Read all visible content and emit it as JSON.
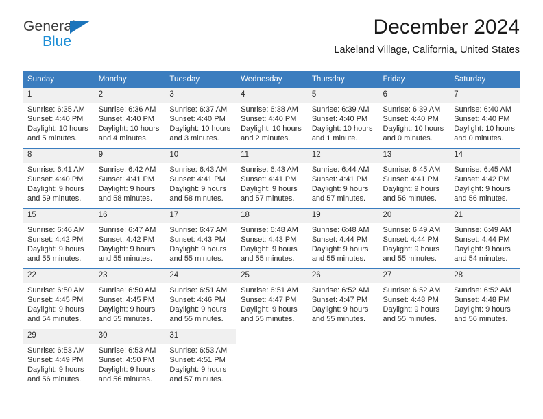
{
  "brand": {
    "name_top": "General",
    "name_bottom": "Blue",
    "triangle_color": "#1b74bb",
    "bottom_color": "#1f8fd6"
  },
  "header": {
    "month_title": "December 2024",
    "location": "Lakeland Village, California, United States",
    "header_bg": "#3b7dbf",
    "daynum_bg": "#f0f0f0"
  },
  "weekday_headers": [
    "Sunday",
    "Monday",
    "Tuesday",
    "Wednesday",
    "Thursday",
    "Friday",
    "Saturday"
  ],
  "weeks": [
    [
      {
        "day": "1",
        "lines": [
          "Sunrise: 6:35 AM",
          "Sunset: 4:40 PM",
          "Daylight: 10 hours",
          "and 5 minutes."
        ]
      },
      {
        "day": "2",
        "lines": [
          "Sunrise: 6:36 AM",
          "Sunset: 4:40 PM",
          "Daylight: 10 hours",
          "and 4 minutes."
        ]
      },
      {
        "day": "3",
        "lines": [
          "Sunrise: 6:37 AM",
          "Sunset: 4:40 PM",
          "Daylight: 10 hours",
          "and 3 minutes."
        ]
      },
      {
        "day": "4",
        "lines": [
          "Sunrise: 6:38 AM",
          "Sunset: 4:40 PM",
          "Daylight: 10 hours",
          "and 2 minutes."
        ]
      },
      {
        "day": "5",
        "lines": [
          "Sunrise: 6:39 AM",
          "Sunset: 4:40 PM",
          "Daylight: 10 hours",
          "and 1 minute."
        ]
      },
      {
        "day": "6",
        "lines": [
          "Sunrise: 6:39 AM",
          "Sunset: 4:40 PM",
          "Daylight: 10 hours",
          "and 0 minutes."
        ]
      },
      {
        "day": "7",
        "lines": [
          "Sunrise: 6:40 AM",
          "Sunset: 4:40 PM",
          "Daylight: 10 hours",
          "and 0 minutes."
        ]
      }
    ],
    [
      {
        "day": "8",
        "lines": [
          "Sunrise: 6:41 AM",
          "Sunset: 4:40 PM",
          "Daylight: 9 hours",
          "and 59 minutes."
        ]
      },
      {
        "day": "9",
        "lines": [
          "Sunrise: 6:42 AM",
          "Sunset: 4:41 PM",
          "Daylight: 9 hours",
          "and 58 minutes."
        ]
      },
      {
        "day": "10",
        "lines": [
          "Sunrise: 6:43 AM",
          "Sunset: 4:41 PM",
          "Daylight: 9 hours",
          "and 58 minutes."
        ]
      },
      {
        "day": "11",
        "lines": [
          "Sunrise: 6:43 AM",
          "Sunset: 4:41 PM",
          "Daylight: 9 hours",
          "and 57 minutes."
        ]
      },
      {
        "day": "12",
        "lines": [
          "Sunrise: 6:44 AM",
          "Sunset: 4:41 PM",
          "Daylight: 9 hours",
          "and 57 minutes."
        ]
      },
      {
        "day": "13",
        "lines": [
          "Sunrise: 6:45 AM",
          "Sunset: 4:41 PM",
          "Daylight: 9 hours",
          "and 56 minutes."
        ]
      },
      {
        "day": "14",
        "lines": [
          "Sunrise: 6:45 AM",
          "Sunset: 4:42 PM",
          "Daylight: 9 hours",
          "and 56 minutes."
        ]
      }
    ],
    [
      {
        "day": "15",
        "lines": [
          "Sunrise: 6:46 AM",
          "Sunset: 4:42 PM",
          "Daylight: 9 hours",
          "and 55 minutes."
        ]
      },
      {
        "day": "16",
        "lines": [
          "Sunrise: 6:47 AM",
          "Sunset: 4:42 PM",
          "Daylight: 9 hours",
          "and 55 minutes."
        ]
      },
      {
        "day": "17",
        "lines": [
          "Sunrise: 6:47 AM",
          "Sunset: 4:43 PM",
          "Daylight: 9 hours",
          "and 55 minutes."
        ]
      },
      {
        "day": "18",
        "lines": [
          "Sunrise: 6:48 AM",
          "Sunset: 4:43 PM",
          "Daylight: 9 hours",
          "and 55 minutes."
        ]
      },
      {
        "day": "19",
        "lines": [
          "Sunrise: 6:48 AM",
          "Sunset: 4:44 PM",
          "Daylight: 9 hours",
          "and 55 minutes."
        ]
      },
      {
        "day": "20",
        "lines": [
          "Sunrise: 6:49 AM",
          "Sunset: 4:44 PM",
          "Daylight: 9 hours",
          "and 55 minutes."
        ]
      },
      {
        "day": "21",
        "lines": [
          "Sunrise: 6:49 AM",
          "Sunset: 4:44 PM",
          "Daylight: 9 hours",
          "and 54 minutes."
        ]
      }
    ],
    [
      {
        "day": "22",
        "lines": [
          "Sunrise: 6:50 AM",
          "Sunset: 4:45 PM",
          "Daylight: 9 hours",
          "and 54 minutes."
        ]
      },
      {
        "day": "23",
        "lines": [
          "Sunrise: 6:50 AM",
          "Sunset: 4:45 PM",
          "Daylight: 9 hours",
          "and 55 minutes."
        ]
      },
      {
        "day": "24",
        "lines": [
          "Sunrise: 6:51 AM",
          "Sunset: 4:46 PM",
          "Daylight: 9 hours",
          "and 55 minutes."
        ]
      },
      {
        "day": "25",
        "lines": [
          "Sunrise: 6:51 AM",
          "Sunset: 4:47 PM",
          "Daylight: 9 hours",
          "and 55 minutes."
        ]
      },
      {
        "day": "26",
        "lines": [
          "Sunrise: 6:52 AM",
          "Sunset: 4:47 PM",
          "Daylight: 9 hours",
          "and 55 minutes."
        ]
      },
      {
        "day": "27",
        "lines": [
          "Sunrise: 6:52 AM",
          "Sunset: 4:48 PM",
          "Daylight: 9 hours",
          "and 55 minutes."
        ]
      },
      {
        "day": "28",
        "lines": [
          "Sunrise: 6:52 AM",
          "Sunset: 4:48 PM",
          "Daylight: 9 hours",
          "and 56 minutes."
        ]
      }
    ],
    [
      {
        "day": "29",
        "lines": [
          "Sunrise: 6:53 AM",
          "Sunset: 4:49 PM",
          "Daylight: 9 hours",
          "and 56 minutes."
        ]
      },
      {
        "day": "30",
        "lines": [
          "Sunrise: 6:53 AM",
          "Sunset: 4:50 PM",
          "Daylight: 9 hours",
          "and 56 minutes."
        ]
      },
      {
        "day": "31",
        "lines": [
          "Sunrise: 6:53 AM",
          "Sunset: 4:51 PM",
          "Daylight: 9 hours",
          "and 57 minutes."
        ]
      },
      {
        "day": "",
        "lines": []
      },
      {
        "day": "",
        "lines": []
      },
      {
        "day": "",
        "lines": []
      },
      {
        "day": "",
        "lines": []
      }
    ]
  ]
}
